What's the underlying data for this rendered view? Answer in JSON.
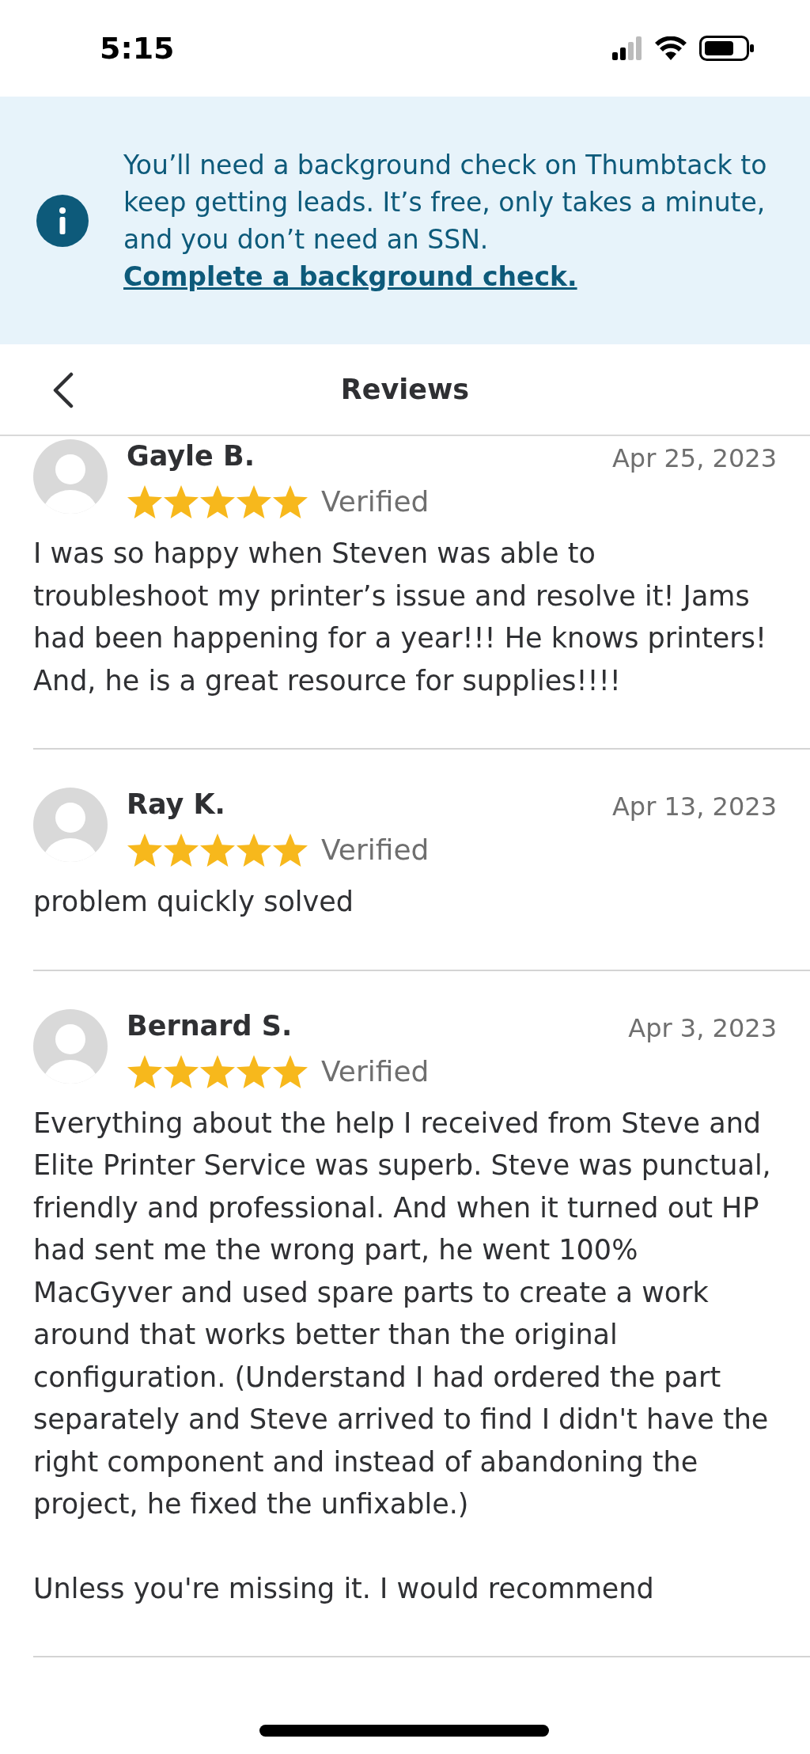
{
  "status_bar": {
    "time": "5:15"
  },
  "banner": {
    "text": "You’ll need a background check on Thumbtack to keep getting leads. It’s free, only takes a minute, and you don’t need an SSN.",
    "link": "Complete a background check."
  },
  "header": {
    "title": "Reviews"
  },
  "reviews": [
    {
      "name": "Gayle B.",
      "stars": 5,
      "badge": "Verified",
      "date": "Apr 25, 2023",
      "paragraphs": [
        "I was so happy when Steven was able to troubleshoot my printer’s issue and resolve it! Jams had been happening for a year!!! He knows printers! And, he is a great resource for supplies!!!!"
      ]
    },
    {
      "name": "Ray K.",
      "stars": 5,
      "badge": "Verified",
      "date": "Apr 13, 2023",
      "paragraphs": [
        "problem quickly solved"
      ]
    },
    {
      "name": "Bernard S.",
      "stars": 5,
      "badge": "Verified",
      "date": "Apr 3, 2023",
      "paragraphs": [
        "Everything about the help I received from Steve and Elite Printer Service was superb. Steve was punctual, friendly and professional. And when it turned out HP had sent me the wrong part, he went 100% MacGyver and used spare parts to create a work around that works better than the original configuration. (Understand I had ordered the part separately and Steve arrived to find I didn't have the right component and instead of abandoning the project, he fixed the unfixable.)",
        "Unless you're missing it. I would recommend"
      ]
    }
  ]
}
